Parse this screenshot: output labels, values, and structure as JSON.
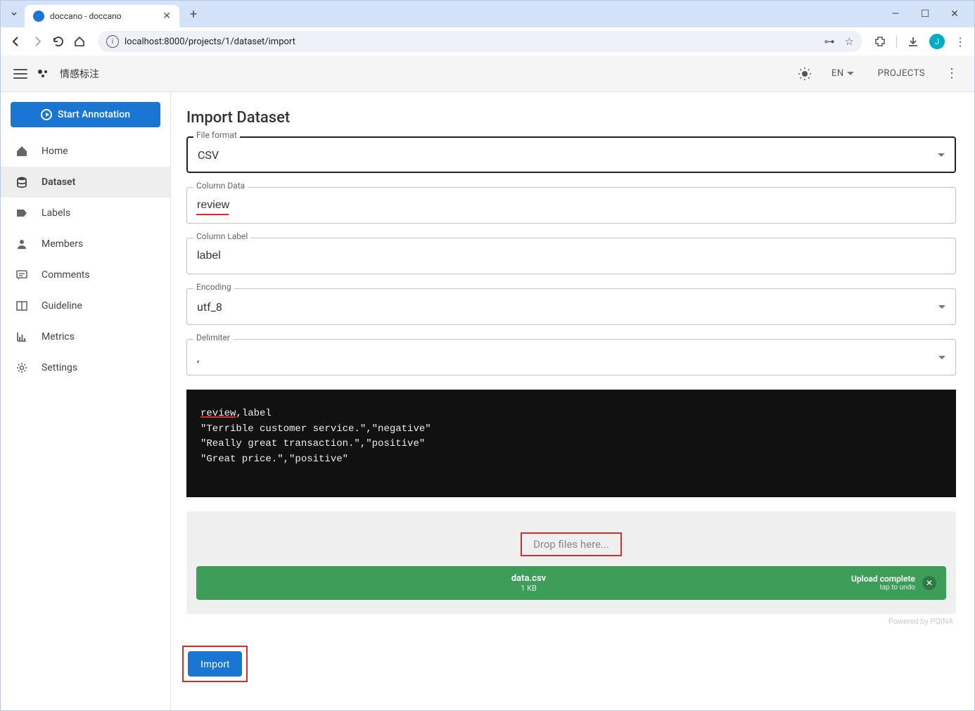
{
  "browser": {
    "tab_title": "doccano - doccano",
    "url_display": "localhost:8000/projects/1/dataset/import",
    "avatar_letter": "J"
  },
  "header": {
    "project_name": "情感标注",
    "lang": "EN",
    "projects_label": "Projects"
  },
  "sidebar": {
    "start_label": "Start Annotation",
    "items": [
      {
        "label": "Home"
      },
      {
        "label": "Dataset"
      },
      {
        "label": "Labels"
      },
      {
        "label": "Members"
      },
      {
        "label": "Comments"
      },
      {
        "label": "Guideline"
      },
      {
        "label": "Metrics"
      },
      {
        "label": "Settings"
      }
    ]
  },
  "page": {
    "title": "Import Dataset",
    "fields": {
      "file_format_label": "File format",
      "file_format_value": "CSV",
      "column_data_label": "Column Data",
      "column_data_value": "review",
      "column_label_label": "Column Label",
      "column_label_value": "label",
      "encoding_label": "Encoding",
      "encoding_value": "utf_8",
      "delimiter_label": "Delimiter",
      "delimiter_value": ","
    },
    "preview_lines": [
      "review,label",
      "\"Terrible customer service.\",\"negative\"",
      "\"Really great transaction.\",\"positive\"",
      "\"Great price.\",\"positive\""
    ],
    "drop_text": "Drop files here...",
    "upload": {
      "filename": "data.csv",
      "size": "1 KB",
      "status": "Upload complete",
      "undo": "tap to undo"
    },
    "powered": "Powered by PQINA",
    "import_label": "Import"
  }
}
